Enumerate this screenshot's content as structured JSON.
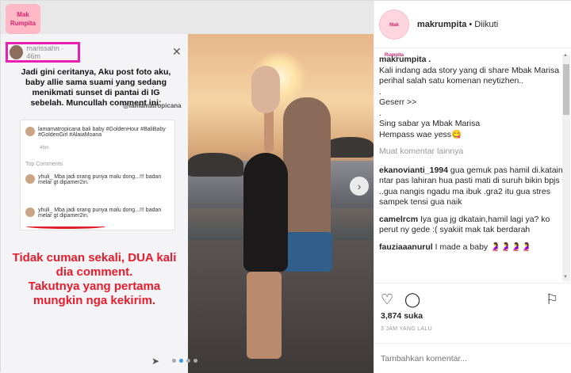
{
  "header": {
    "username": "makrumpita",
    "separator": "•",
    "follow_state": "Diikuti",
    "avatar_text": "Mak Rumpita"
  },
  "story": {
    "logo_text": "Mak Rumpita",
    "user": "marissahn · 46m",
    "text": "Jadi gini ceritanya, Aku post foto aku, baby allie sama suami yang sedang menikmati sunset di pantai di IG sebelah. Muncullah comment ini:",
    "tag": "@lamamatropicana",
    "card_post": "lamamatropicana bali baby #GoldenHour #BaliBaby #GoldenGirl #AlaiaMoana",
    "card_time": "46m",
    "top_comments": "Top Comments",
    "comment1": "yhuli_ Mba jadi orang punya malu dong...!!! badan melar gt dipamer2in.",
    "comment2": "yhuli_ Mba jadi orang punya malu dong...!!! badan melar gt dipamer2in.",
    "hide_replies": "Hide replies",
    "big_line1": "Tidak cuman sekali, DUA kali dia comment.",
    "big_line2": "Takutnya yang pertama mungkin nga kekirim."
  },
  "caption": {
    "user": "makrumpita .",
    "text": "Kali indang ada story yang di share Mbak Marisa perihal salah satu komenan neytizhen..",
    "dot1": ".",
    "line2": "Geserr >>",
    "dot2": ".",
    "line3": "Sing sabar ya Mbak Marisa",
    "line4": "Hempass wae yess😋"
  },
  "load_more": "Muat komentar lainnya",
  "comments": [
    {
      "user": "ekanovianti_1994",
      "text": "gua gemuk pas hamil di.katain ntar pas lahiran hua pasti mati di suruh bikin bpjs ..gua nangis ngadu ma ibuk .gra2 itu gua stres sampek tensi gua naik"
    },
    {
      "user": "camelrcm",
      "text": "Iya gua jg dkatain,hamil lagi ya? ko perut ny gede :( syakiit mak tak berdarah"
    },
    {
      "user": "fauziaaanurul",
      "text": "I made a baby 🤰🤰🤰🤰"
    }
  ],
  "likes": "3,874 suka",
  "time": "3 JAM YANG LALU",
  "comment_placeholder": "Tambahkan komentar...",
  "icons": {
    "like": "heart-icon",
    "comment": "comment-icon",
    "save": "bookmark-icon",
    "next": "chevron-right-icon",
    "close": "close-icon",
    "send": "send-icon"
  }
}
